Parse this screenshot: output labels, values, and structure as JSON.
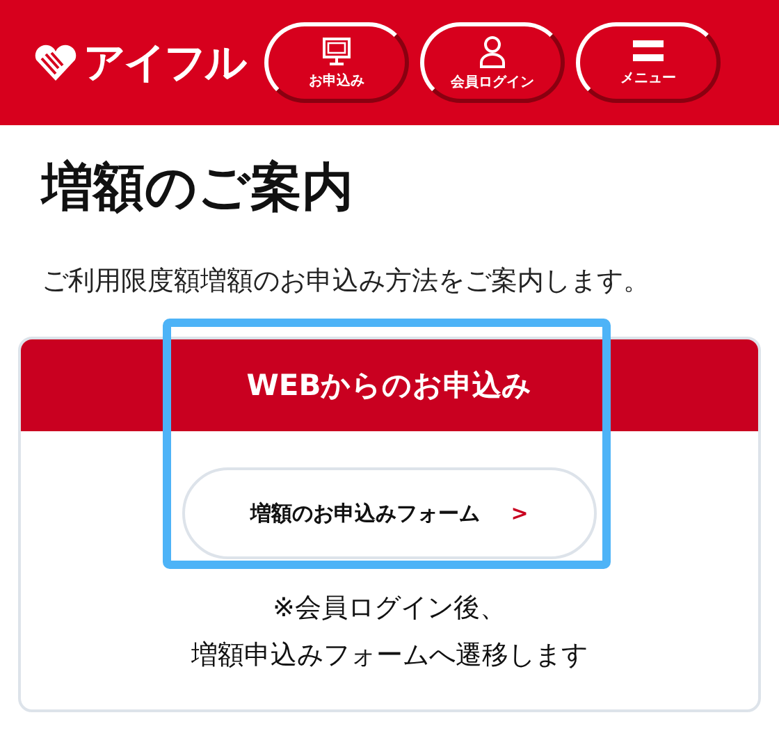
{
  "header": {
    "logo_text": "アイフル",
    "nav_buttons": [
      {
        "kind": "apply",
        "label": "お申込み"
      },
      {
        "kind": "login",
        "label": "会員ログイン"
      },
      {
        "kind": "menu",
        "label": "メニュー"
      }
    ]
  },
  "page_title": "増額のご案内",
  "intro": "ご利用限度額増額のお申込み方法をご案内します。",
  "web_section": {
    "heading": "WEBからのお申込み",
    "highlighted": true,
    "form_button": {
      "label": "増額のお申込みフォーム",
      "arrow": ">"
    },
    "note_lines": [
      "※会員ログイン後、",
      "増額申込みフォームへ遷移します"
    ]
  }
}
